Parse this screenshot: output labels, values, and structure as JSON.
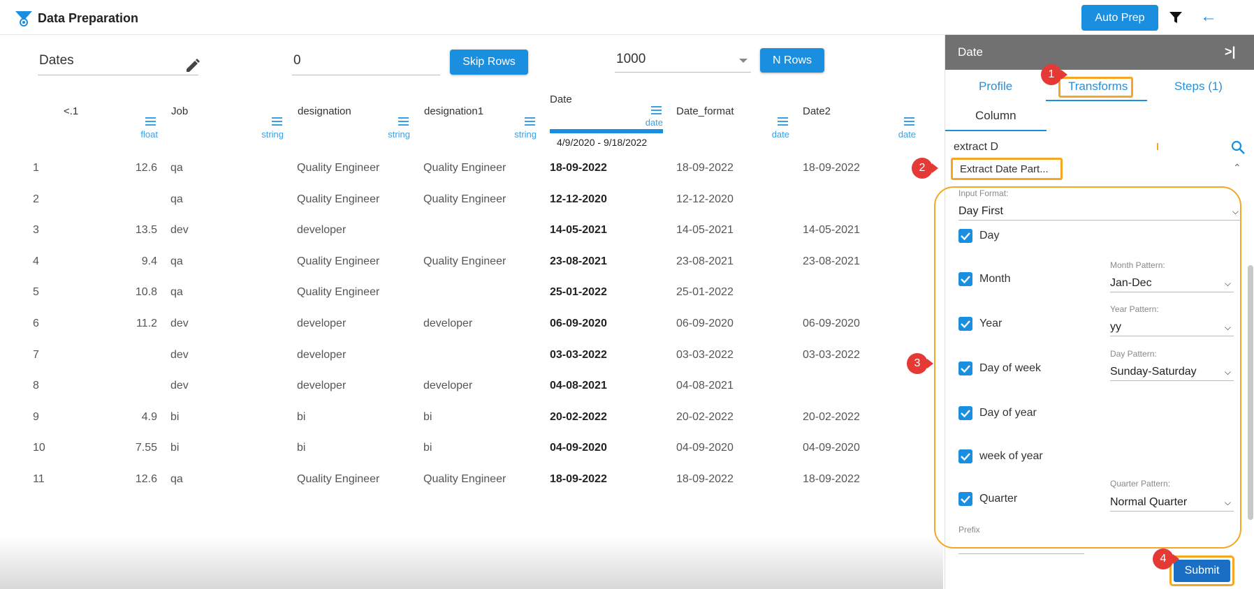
{
  "app": {
    "title": "Data Preparation",
    "auto_prep_label": "Auto Prep",
    "accent": "#1a8fe0",
    "highlight": "#f5a623",
    "badge_color": "#e53935"
  },
  "controls": {
    "dataset_name": "Dates",
    "skip_value": "0",
    "skip_label": "Skip Rows",
    "n_rows_value": "1000",
    "n_rows_label": "N Rows"
  },
  "columns": [
    {
      "name": "<.1",
      "type": "float"
    },
    {
      "name": "Job",
      "type": "string"
    },
    {
      "name": "designation",
      "type": "string"
    },
    {
      "name": "designation1",
      "type": "string"
    },
    {
      "name": "Date",
      "type": "date",
      "range": "4/9/2020 - 9/18/2022"
    },
    {
      "name": "Date_format",
      "type": "date"
    },
    {
      "name": "Date2",
      "type": "date"
    }
  ],
  "rows": [
    [
      "1",
      "12.6",
      "qa",
      "Quality Engineer",
      "Quality Engineer",
      "18-09-2022",
      "18-09-2022",
      "18-09-2022"
    ],
    [
      "2",
      "",
      "qa",
      "Quality Engineer",
      "Quality Engineer",
      "12-12-2020",
      "12-12-2020",
      ""
    ],
    [
      "3",
      "13.5",
      "dev",
      "developer",
      "",
      "14-05-2021",
      "14-05-2021",
      "14-05-2021"
    ],
    [
      "4",
      "9.4",
      "qa",
      "Quality Engineer",
      "Quality Engineer",
      "23-08-2021",
      "23-08-2021",
      "23-08-2021"
    ],
    [
      "5",
      "10.8",
      "qa",
      "Quality Engineer",
      "",
      "25-01-2022",
      "25-01-2022",
      ""
    ],
    [
      "6",
      "11.2",
      "dev",
      "developer",
      "developer",
      "06-09-2020",
      "06-09-2020",
      "06-09-2020"
    ],
    [
      "7",
      "",
      "dev",
      "developer",
      "",
      "03-03-2022",
      "03-03-2022",
      "03-03-2022"
    ],
    [
      "8",
      "",
      "dev",
      "developer",
      "developer",
      "04-08-2021",
      "04-08-2021",
      ""
    ],
    [
      "9",
      "4.9",
      "bi",
      "bi",
      "bi",
      "20-02-2022",
      "20-02-2022",
      "20-02-2022"
    ],
    [
      "10",
      "7.55",
      "bi",
      "bi",
      "bi",
      "04-09-2020",
      "04-09-2020",
      "04-09-2020"
    ],
    [
      "11",
      "12.6",
      "qa",
      "Quality Engineer",
      "Quality Engineer",
      "18-09-2022",
      "18-09-2022",
      "18-09-2022"
    ]
  ],
  "panel": {
    "title": "Date",
    "tabs": [
      "Profile",
      "Transforms",
      "Steps (1)"
    ],
    "active_tab": "Transforms",
    "subtab": "Column",
    "search_value": "extract D",
    "transform_name": "Extract Date Part...",
    "input_format_label": "Input Format:",
    "input_format_value": "Day First",
    "options": [
      {
        "label": "Day",
        "checked": true
      },
      {
        "label": "Month",
        "checked": true
      },
      {
        "label": "Year",
        "checked": true
      },
      {
        "label": "Day of week",
        "checked": true
      },
      {
        "label": "Day of year",
        "checked": true
      },
      {
        "label": "week of year",
        "checked": true
      },
      {
        "label": "Quarter",
        "checked": true
      }
    ],
    "month_pattern_label": "Month Pattern:",
    "month_pattern_value": "Jan-Dec",
    "year_pattern_label": "Year Pattern:",
    "year_pattern_value": "yy",
    "day_pattern_label": "Day Pattern:",
    "day_pattern_value": "Sunday-Saturday",
    "quarter_pattern_label": "Quarter Pattern:",
    "quarter_pattern_value": "Normal Quarter",
    "prefix_label": "Prefix",
    "submit_label": "Submit"
  },
  "badges": [
    "1",
    "2",
    "3",
    "4"
  ]
}
